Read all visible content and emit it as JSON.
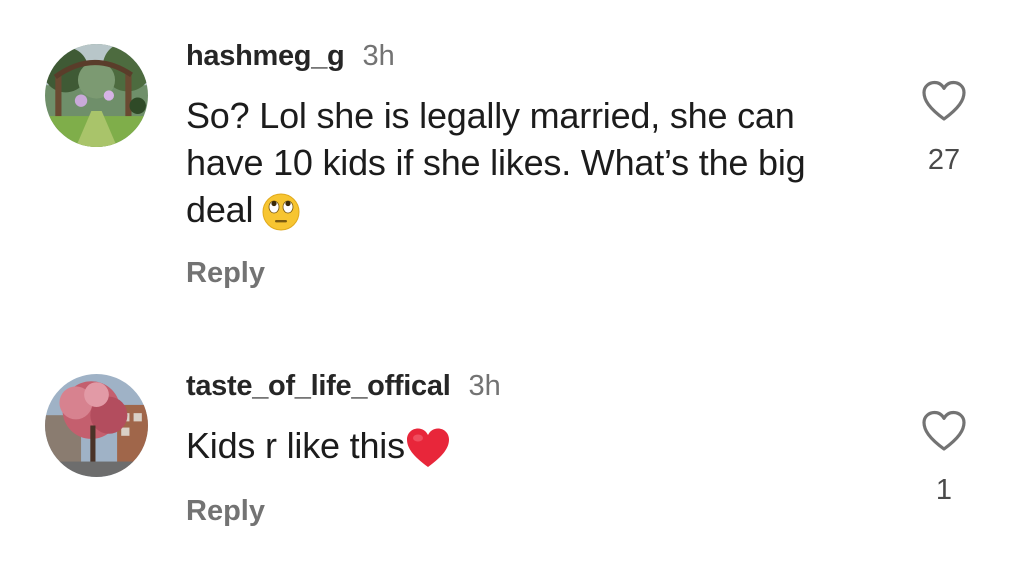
{
  "comments": [
    {
      "username": "hashmeg_g",
      "time": "3h",
      "text": "So? Lol she is legally married, she can have 10 kids if she likes. What’s the big deal",
      "emoji": "face-with-rolling-eyes-icon",
      "reply_label": "Reply",
      "like_count": "27"
    },
    {
      "username": "taste_of_life_offical",
      "time": "3h",
      "text": "Kids r like this",
      "emoji": "red-heart-icon",
      "reply_label": "Reply",
      "like_count": "1"
    }
  ],
  "colors": {
    "username": "#262626",
    "secondary": "#737373",
    "text": "#1c1c1c",
    "heart_emoji": "#e8263a",
    "eyes_emoji": "#f7c531"
  }
}
